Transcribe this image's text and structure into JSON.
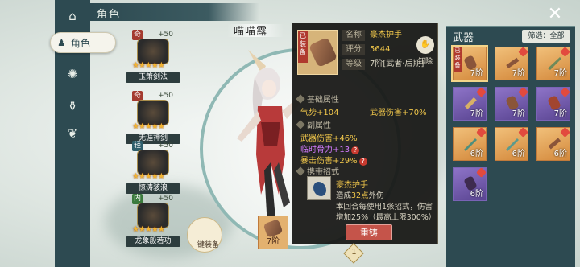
{
  "top_tab": {
    "label": "角色"
  },
  "sidebar": {
    "role_label": "角色"
  },
  "skills": [
    {
      "tag": "奇",
      "level": "+50",
      "name": "玉箫剑法"
    },
    {
      "tag": "奇",
      "level": "+50",
      "name": "无涯神剑"
    },
    {
      "tag": "轻",
      "level": "+50",
      "name": "惊涛骇浪"
    },
    {
      "tag": "内",
      "level": "+50",
      "name": "龙象般若功"
    }
  ],
  "character": {
    "name": "喵喵露"
  },
  "tooltip": {
    "equipped_tag": "已装备",
    "name_key": "名称",
    "name_value": "豪杰护手",
    "score_key": "评分",
    "score_value": "5644",
    "grade_key": "等级",
    "grade_value": "7阶[武者·后期]",
    "unequip_label": "卸除",
    "base_section": "基础属性",
    "base_stat_1": "气势+104",
    "base_stat_2": "武器伤害+70%",
    "sub_section": "副属性",
    "sub_stat_1": "武器伤害+46%",
    "sub_stat_2": "临时骨力+13",
    "sub_stat_3": "暴击伤害+29%",
    "move_section": "携带招式",
    "move_name": "豪杰护手",
    "move_desc_pre": "造成",
    "move_desc_num": "32点",
    "move_desc_post": "外伤",
    "move_desc_2": "本回合每使用1张招式，伤害增加25%（最高上限300%）",
    "equip_button": "重铸"
  },
  "bottom": {
    "slot_grade": "7阶",
    "auto_label": "一键装备",
    "page_badge": "1"
  },
  "weapons_panel": {
    "title": "武器",
    "filter": "筛选：全部",
    "items": [
      {
        "grade": "7阶",
        "color": "gold",
        "equipped": "已装备"
      },
      {
        "grade": "7阶",
        "color": "gold"
      },
      {
        "grade": "7阶",
        "color": "gold"
      },
      {
        "grade": "7阶",
        "color": "purple"
      },
      {
        "grade": "7阶",
        "color": "purple"
      },
      {
        "grade": "7阶",
        "color": "purple"
      },
      {
        "grade": "6阶",
        "color": "gold"
      },
      {
        "grade": "6阶",
        "color": "gold"
      },
      {
        "grade": "6阶",
        "color": "gold"
      },
      {
        "grade": "6阶",
        "color": "purple"
      }
    ]
  }
}
